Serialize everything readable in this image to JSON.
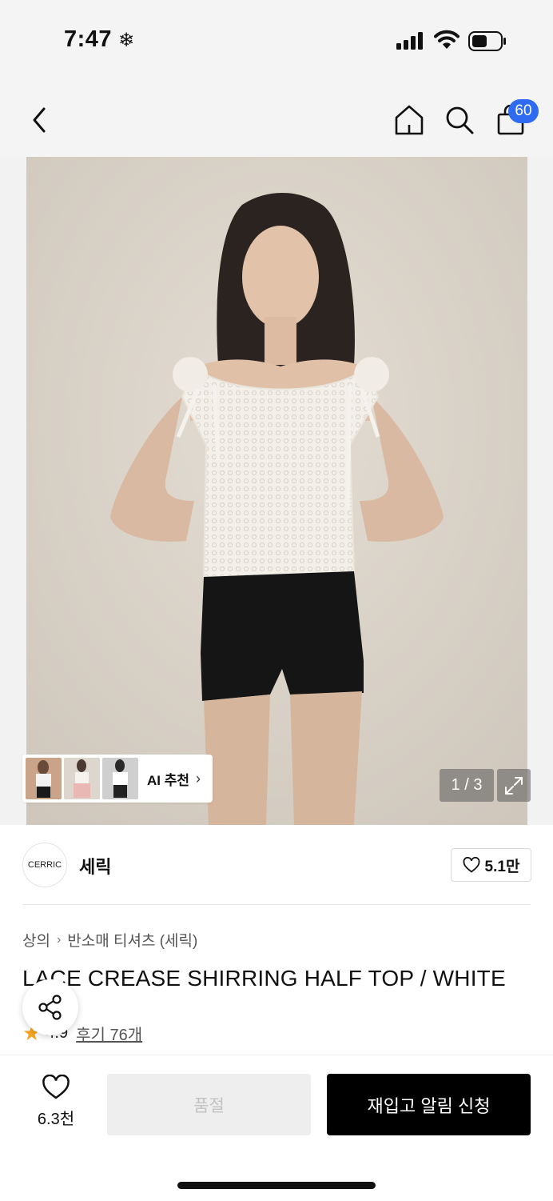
{
  "status_bar": {
    "time": "7:47",
    "time_icon": "❄"
  },
  "header": {
    "cart_count": "60"
  },
  "gallery": {
    "ai_label": "AI 추천",
    "pager": "1 / 3"
  },
  "brand": {
    "logo_text": "CERRIC",
    "name": "세릭",
    "likes": "5.1만"
  },
  "breadcrumb": {
    "level1": "상의",
    "level2": "반소매 티셔츠 (세릭)"
  },
  "product": {
    "title": "LACE CREASE SHIRRING HALF TOP / WHITE",
    "rating": "4.9",
    "reviews": "후기 76개"
  },
  "bottom": {
    "wish_count": "6.3천",
    "soldout_label": "품절",
    "restock_label": "재입고 알림 신청"
  }
}
